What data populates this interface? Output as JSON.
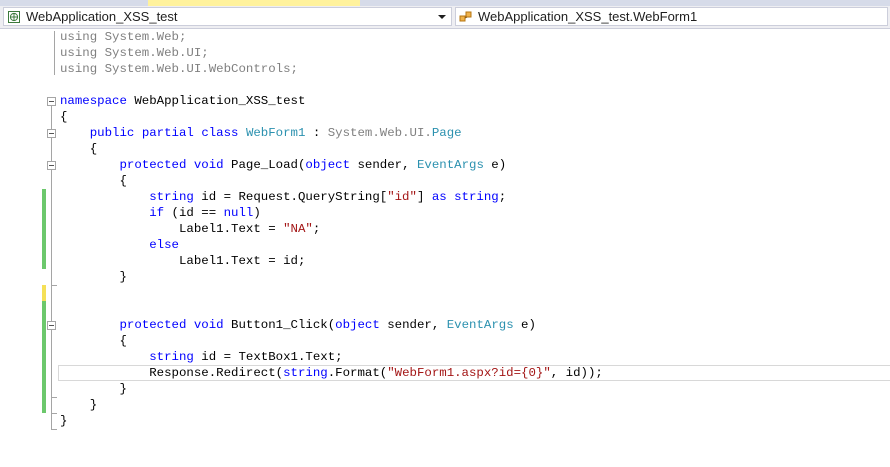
{
  "nav": {
    "left_combo": {
      "text": "WebApplication_XSS_test",
      "icon": "csharp-project-icon"
    },
    "right_combo": {
      "text": "WebApplication_XSS_test.WebForm1",
      "icon": "class-icon"
    }
  },
  "code": {
    "lines": [
      [
        {
          "c": "u",
          "t": "using "
        },
        {
          "c": "u",
          "t": "System.Web;"
        }
      ],
      [
        {
          "c": "u",
          "t": "using "
        },
        {
          "c": "u",
          "t": "System.Web.UI;"
        }
      ],
      [
        {
          "c": "u",
          "t": "using "
        },
        {
          "c": "u",
          "t": "System.Web.UI.WebControls;"
        }
      ],
      [],
      [
        {
          "c": "k",
          "t": "namespace"
        },
        {
          "c": "",
          "t": " WebApplication_XSS_test"
        }
      ],
      [
        {
          "c": "",
          "t": "{"
        }
      ],
      [
        {
          "c": "",
          "t": "    "
        },
        {
          "c": "k",
          "t": "public"
        },
        {
          "c": "",
          "t": " "
        },
        {
          "c": "k",
          "t": "partial"
        },
        {
          "c": "",
          "t": " "
        },
        {
          "c": "k",
          "t": "class"
        },
        {
          "c": "",
          "t": " "
        },
        {
          "c": "t",
          "t": "WebForm1"
        },
        {
          "c": "",
          "t": " : "
        },
        {
          "c": "u",
          "t": "System.Web.UI."
        },
        {
          "c": "t",
          "t": "Page"
        }
      ],
      [
        {
          "c": "",
          "t": "    {"
        }
      ],
      [
        {
          "c": "",
          "t": "        "
        },
        {
          "c": "k",
          "t": "protected"
        },
        {
          "c": "",
          "t": " "
        },
        {
          "c": "k",
          "t": "void"
        },
        {
          "c": "",
          "t": " Page_Load("
        },
        {
          "c": "k",
          "t": "object"
        },
        {
          "c": "",
          "t": " sender, "
        },
        {
          "c": "t",
          "t": "EventArgs"
        },
        {
          "c": "",
          "t": " e)"
        }
      ],
      [
        {
          "c": "",
          "t": "        {"
        }
      ],
      [
        {
          "c": "",
          "t": "            "
        },
        {
          "c": "k",
          "t": "string"
        },
        {
          "c": "",
          "t": " id = Request.QueryString["
        },
        {
          "c": "s",
          "t": "\"id\""
        },
        {
          "c": "",
          "t": "] "
        },
        {
          "c": "k",
          "t": "as"
        },
        {
          "c": "",
          "t": " "
        },
        {
          "c": "k",
          "t": "string"
        },
        {
          "c": "",
          "t": ";"
        }
      ],
      [
        {
          "c": "",
          "t": "            "
        },
        {
          "c": "k",
          "t": "if"
        },
        {
          "c": "",
          "t": " (id == "
        },
        {
          "c": "k",
          "t": "null"
        },
        {
          "c": "",
          "t": ")"
        }
      ],
      [
        {
          "c": "",
          "t": "                Label1.Text = "
        },
        {
          "c": "s",
          "t": "\"NA\""
        },
        {
          "c": "",
          "t": ";"
        }
      ],
      [
        {
          "c": "",
          "t": "            "
        },
        {
          "c": "k",
          "t": "else"
        }
      ],
      [
        {
          "c": "",
          "t": "                Label1.Text = id;"
        }
      ],
      [
        {
          "c": "",
          "t": "        }"
        }
      ],
      [],
      [],
      [
        {
          "c": "",
          "t": "        "
        },
        {
          "c": "k",
          "t": "protected"
        },
        {
          "c": "",
          "t": " "
        },
        {
          "c": "k",
          "t": "void"
        },
        {
          "c": "",
          "t": " Button1_Click("
        },
        {
          "c": "k",
          "t": "object"
        },
        {
          "c": "",
          "t": " sender, "
        },
        {
          "c": "t",
          "t": "EventArgs"
        },
        {
          "c": "",
          "t": " e)"
        }
      ],
      [
        {
          "c": "",
          "t": "        {"
        }
      ],
      [
        {
          "c": "",
          "t": "            "
        },
        {
          "c": "k",
          "t": "string"
        },
        {
          "c": "",
          "t": " id = TextBox1.Text;"
        }
      ],
      [
        {
          "c": "",
          "t": "            Response.Redirect("
        },
        {
          "c": "k",
          "t": "string"
        },
        {
          "c": "",
          "t": ".Format("
        },
        {
          "c": "s",
          "t": "\"WebForm1.aspx?id={0}\""
        },
        {
          "c": "",
          "t": ", id));"
        }
      ],
      [
        {
          "c": "",
          "t": "        }"
        }
      ],
      [
        {
          "c": "",
          "t": "    }"
        }
      ],
      [
        {
          "c": "",
          "t": "}"
        }
      ]
    ]
  },
  "colors": {
    "keyword": "#0000ff",
    "type": "#2b91af",
    "string": "#a31515",
    "gray_using": "#808080",
    "changed_saved": "#6cc86c",
    "changed_unsaved": "#f5e057",
    "active_tab": "#fff29d"
  }
}
